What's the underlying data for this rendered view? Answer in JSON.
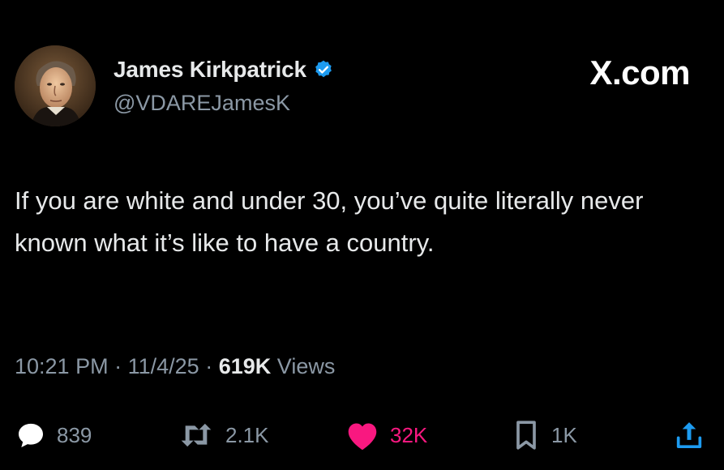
{
  "author": {
    "display_name": "James Kirkpatrick",
    "handle": "@VDAREJamesK",
    "verified_icon": "verified-badge-icon",
    "avatar": "portrait-avatar"
  },
  "brand": {
    "label": "X.com"
  },
  "tweet": {
    "text": "If you are white and under 30, you’ve quite literally never known what it’s like to have a country."
  },
  "meta": {
    "time": "10:21 PM",
    "separator": "·",
    "date": "11/4/25",
    "views_count": "619K",
    "views_label": "Views"
  },
  "actions": {
    "replies": {
      "icon": "reply-icon",
      "count": "839"
    },
    "reposts": {
      "icon": "repost-icon",
      "count": "2.1K"
    },
    "likes": {
      "icon": "heart-icon",
      "count": "32K",
      "liked": true
    },
    "bookmarks": {
      "icon": "bookmark-icon",
      "count": "1K"
    },
    "share": {
      "icon": "share-icon"
    }
  },
  "colors": {
    "background": "#000000",
    "primary_text": "#e7e9ea",
    "secondary_text": "#8b98a5",
    "verified_blue": "#1d9bf0",
    "like_pink": "#f91880"
  }
}
